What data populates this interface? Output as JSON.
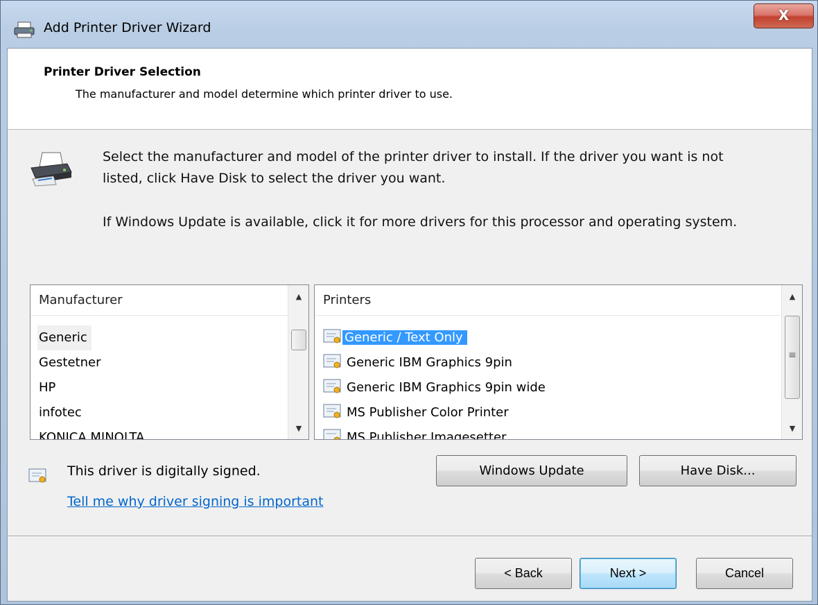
{
  "window": {
    "title": "Add Printer Driver Wizard",
    "close_glyph": "X"
  },
  "header": {
    "title": "Printer Driver Selection",
    "subtitle": "The manufacturer and model determine which printer driver to use."
  },
  "instructions": {
    "line1": "Select the manufacturer and model of the printer driver to install. If the driver you want is not",
    "line2": "listed, click Have Disk to select the driver you want.",
    "line3": "If Windows Update is available, click it for more drivers for this processor and operating system."
  },
  "manufacturer_list": {
    "header": "Manufacturer",
    "items": [
      "Generic",
      "Gestetner",
      "HP",
      "infotec",
      "KONICA MINOLTA"
    ],
    "selected": "Generic"
  },
  "printers_list": {
    "header": "Printers",
    "items": [
      "Generic / Text Only",
      "Generic IBM Graphics 9pin",
      "Generic IBM Graphics 9pin wide",
      "MS Publisher Color Printer",
      "MS Publisher Imagesetter"
    ],
    "selected": "Generic / Text Only"
  },
  "buttons": {
    "windows_update": "Windows Update",
    "have_disk": "Have Disk...",
    "back": "< Back",
    "next": "Next >",
    "cancel": "Cancel"
  },
  "signing": {
    "status": "This driver is digitally signed.",
    "link": "Tell me why driver signing is important"
  },
  "icons": {
    "title": "printer-icon",
    "wizard": "printer-icon",
    "cert": "certificate-icon",
    "scroll_up": "▲",
    "scroll_down": "▼",
    "grip": "≡"
  },
  "colors": {
    "selection": "#3399ff",
    "link": "#0066cc",
    "close": "#c2412f"
  }
}
